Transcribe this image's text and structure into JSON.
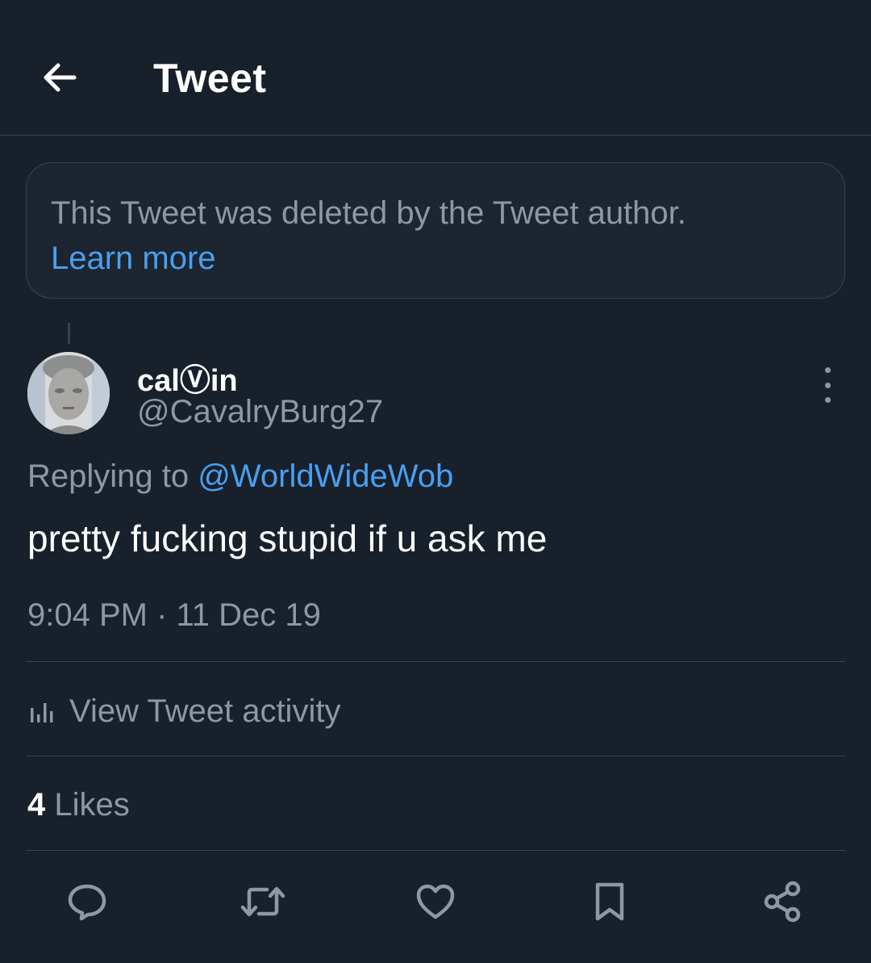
{
  "header": {
    "title": "Tweet",
    "back_icon": "arrow-left-icon"
  },
  "notice": {
    "text": "This Tweet was deleted by the Tweet author.",
    "link": "Learn more"
  },
  "tweet": {
    "display_name": "calⓋin",
    "handle": "@CavalryBurg27",
    "replying_prefix": "Replying to ",
    "replying_to": "@WorldWideWob",
    "text": "pretty fucking stupid if u ask me",
    "timestamp": "9:04 PM · 11 Dec 19"
  },
  "activity": {
    "label": "View Tweet activity",
    "icon": "bar-chart-icon"
  },
  "stats": {
    "likes_count": "4",
    "likes_label": " Likes"
  },
  "actions": [
    "reply-icon",
    "retweet-icon",
    "like-icon",
    "bookmark-icon",
    "share-icon"
  ],
  "colors": {
    "background": "#18202b",
    "accent": "#4a9ff0",
    "muted": "#8b98a5",
    "border": "#38444d"
  }
}
